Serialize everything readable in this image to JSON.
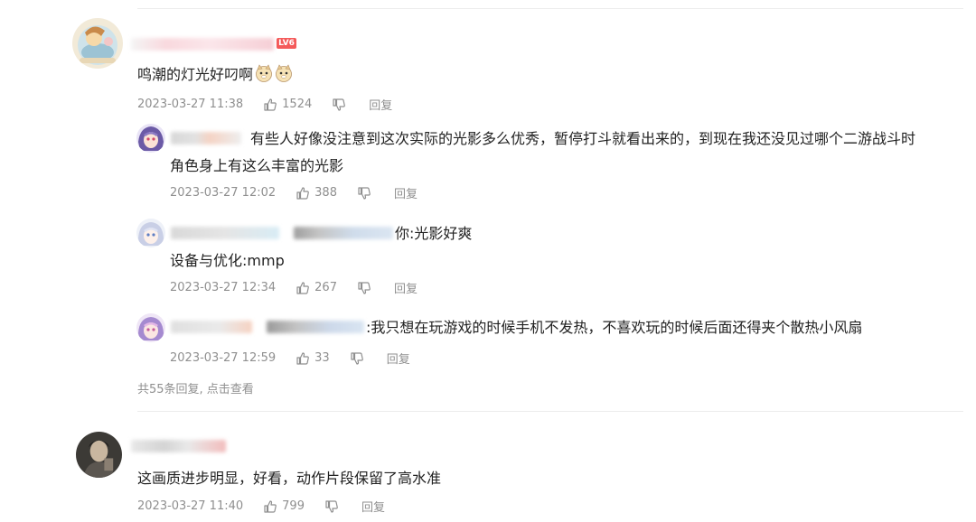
{
  "comments": [
    {
      "text": "鸣潮的灯光好叼啊",
      "emoji_name": "doge-emoji",
      "level": "LV6",
      "time": "2023-03-27 11:38",
      "likes": "1524",
      "reply_label": "回复",
      "replies": [
        {
          "text_line1": "有些人好像没注意到这次实际的光影多么优秀，暂停打斗就看出来的，到现在我还没见过哪个二游战斗时",
          "text_line2": "角色身上有这么丰富的光影",
          "time": "2023-03-27 12:02",
          "likes": "388",
          "reply_label": "回复"
        },
        {
          "text_line1": "你:光影好爽",
          "text_line2": "设备与优化:mmp",
          "time": "2023-03-27 12:34",
          "likes": "267",
          "reply_label": "回复"
        },
        {
          "text_line1": ":我只想在玩游戏的时候手机不发热，不喜欢玩的时候后面还得夹个散热小风扇",
          "time": "2023-03-27 12:59",
          "likes": "33",
          "reply_label": "回复"
        }
      ],
      "more_replies": "共55条回复, 点击查看"
    },
    {
      "text": "这画质进步明显，好看，动作片段保留了高水准",
      "time": "2023-03-27 11:40",
      "likes": "799",
      "reply_label": "回复"
    }
  ],
  "icons": {
    "like": "thumbs-up-icon",
    "dislike": "thumbs-down-icon"
  },
  "colors": {
    "meta_text": "#8f8f8f",
    "level_badge": "#f45a5a",
    "divider": "#ececec"
  }
}
